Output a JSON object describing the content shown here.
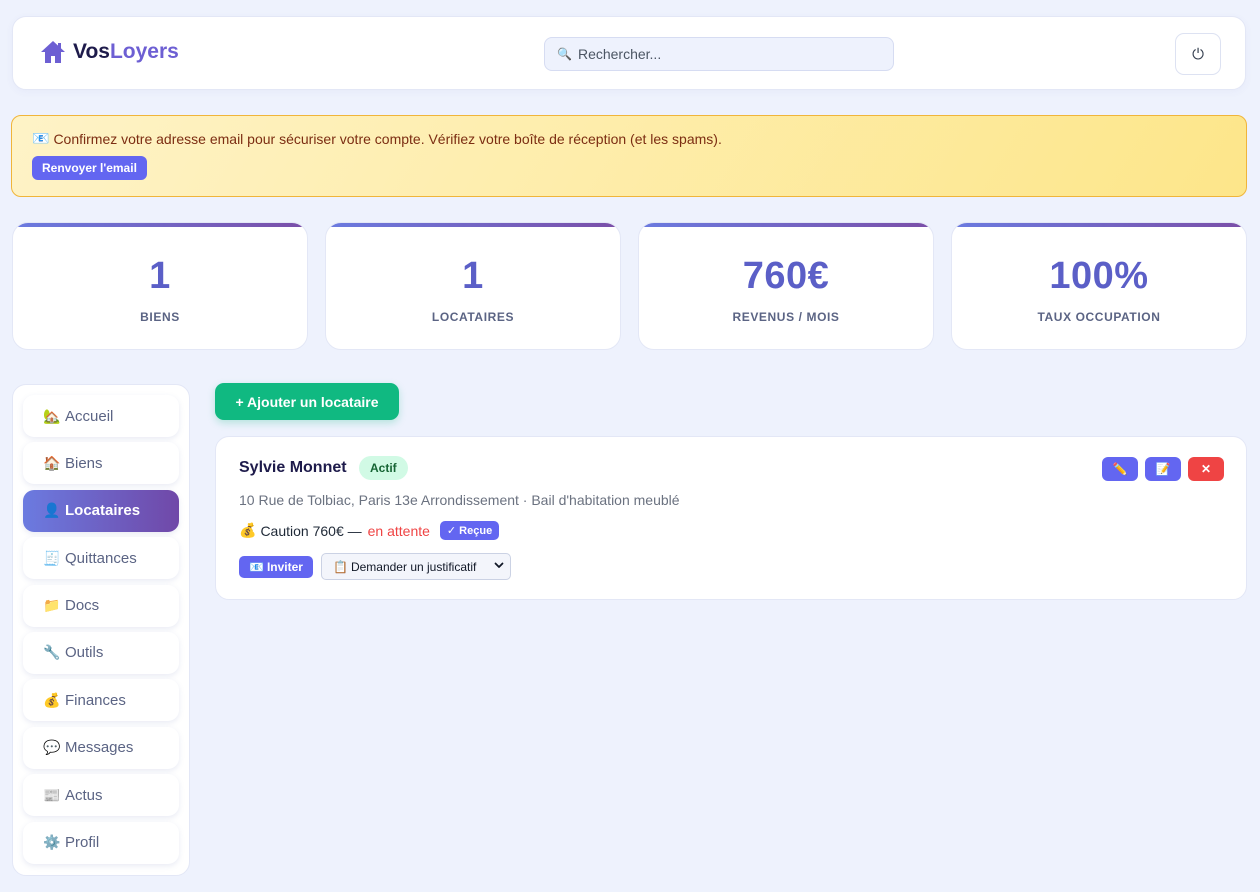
{
  "header": {
    "logo_vos": "Vos",
    "logo_loyers": "Loyers",
    "search_placeholder": "Rechercher...",
    "search_icon": "🔍",
    "power_icon": "⏻"
  },
  "alert": {
    "icon": "📧",
    "text": "Confirmez votre adresse email pour sécuriser votre compte. Vérifiez votre boîte de réception (et les spams).",
    "button_label": "Renvoyer l'email"
  },
  "stats": [
    {
      "value": "1",
      "label": "BIENS"
    },
    {
      "value": "1",
      "label": "LOCATAIRES"
    },
    {
      "value": "760€",
      "label": "REVENUS / MOIS"
    },
    {
      "value": "100%",
      "label": "TAUX OCCUPATION"
    }
  ],
  "sidebar": {
    "items": [
      {
        "icon": "🏡",
        "label": "Accueil"
      },
      {
        "icon": "🏠",
        "label": "Biens"
      },
      {
        "icon": "👤",
        "label": "Locataires"
      },
      {
        "icon": "🧾",
        "label": "Quittances"
      },
      {
        "icon": "📁",
        "label": "Docs"
      },
      {
        "icon": "🔧",
        "label": "Outils"
      },
      {
        "icon": "💰",
        "label": "Finances"
      },
      {
        "icon": "💬",
        "label": "Messages"
      },
      {
        "icon": "📰",
        "label": "Actus"
      },
      {
        "icon": "⚙️",
        "label": "Profil"
      }
    ],
    "active_index": 2
  },
  "main": {
    "add_button_label": "+ Ajouter un locataire",
    "tenant": {
      "name": "Sylvie Monnet",
      "status": "Actif",
      "address": "10 Rue de Tolbiac, Paris 13e Arrondissement · Bail d'habitation meublé",
      "deposit_icon": "💰",
      "deposit_text": "Caution 760€ —",
      "deposit_status": "en attente",
      "received_label": "✓ Reçue",
      "invite_icon": "📧",
      "invite_label": "Inviter",
      "request_icon": "📋",
      "request_label": "Demander un justificatif",
      "edit_icon": "✏️",
      "note_icon": "📝",
      "delete_icon": "✕"
    }
  },
  "colors": {
    "accent": "#6366f1",
    "success": "#10b981",
    "danger": "#ef4444",
    "alert_bg": "#fde68a"
  }
}
